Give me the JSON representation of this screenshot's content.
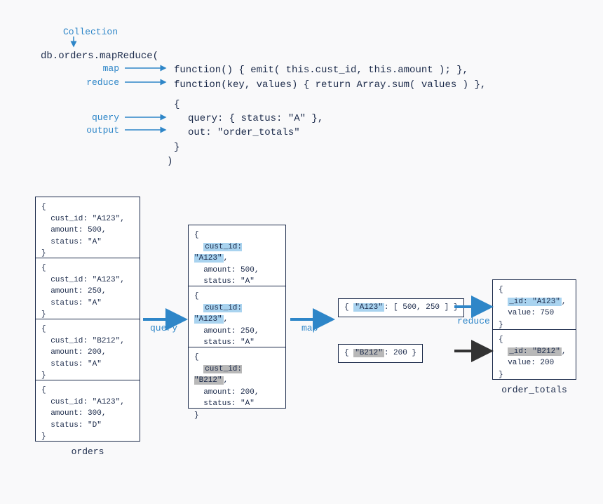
{
  "header": {
    "collection_label": "Collection"
  },
  "code": {
    "line1": "db.orders.mapReduce(",
    "map_fn": "function() { emit( this.cust_id, this.amount ); },",
    "reduce_fn": "function(key, values) { return Array.sum( values ) },",
    "opts_open": "{",
    "opts_query": "query: { status: \"A\" },",
    "opts_out": "out: \"order_totals\"",
    "opts_close": "}",
    "close_paren": ")"
  },
  "annotations": {
    "map": "map",
    "reduce": "reduce",
    "query": "query",
    "output": "output"
  },
  "steps": {
    "query": "query",
    "map": "map",
    "reduce": "reduce"
  },
  "orders": {
    "label": "orders",
    "docs": [
      {
        "cust_id": "cust_id: \"A123\",",
        "amount": "amount: 500,",
        "status": "status: \"A\""
      },
      {
        "cust_id": "cust_id: \"A123\",",
        "amount": "amount: 250,",
        "status": "status: \"A\""
      },
      {
        "cust_id": "cust_id: \"B212\",",
        "amount": "amount: 200,",
        "status": "status: \"A\""
      },
      {
        "cust_id": "cust_id: \"A123\",",
        "amount": "amount: 300,",
        "status": "status: \"D\""
      }
    ]
  },
  "filtered": {
    "docs": [
      {
        "cust_id_hl": "cust_id: \"A123\"",
        "amount": "amount: 500,",
        "status": "status: \"A\""
      },
      {
        "cust_id_hl": "cust_id: \"A123\"",
        "amount": "amount: 250,",
        "status": "status: \"A\""
      },
      {
        "cust_id_hl": "cust_id: \"B212\"",
        "amount": "amount: 200,",
        "status": "status: \"A\""
      }
    ]
  },
  "mapped": {
    "a123": {
      "key": "\"A123\"",
      "vals": ": [ 500, 250 ]"
    },
    "b212": {
      "key": "\"B212\"",
      "vals": ": 200"
    }
  },
  "results": {
    "label": "order_totals",
    "docs": [
      {
        "id_hl": "_id: \"A123\"",
        "value": "value: 750"
      },
      {
        "id_hl": "_id: \"B212\"",
        "value": "value: 200"
      }
    ]
  }
}
